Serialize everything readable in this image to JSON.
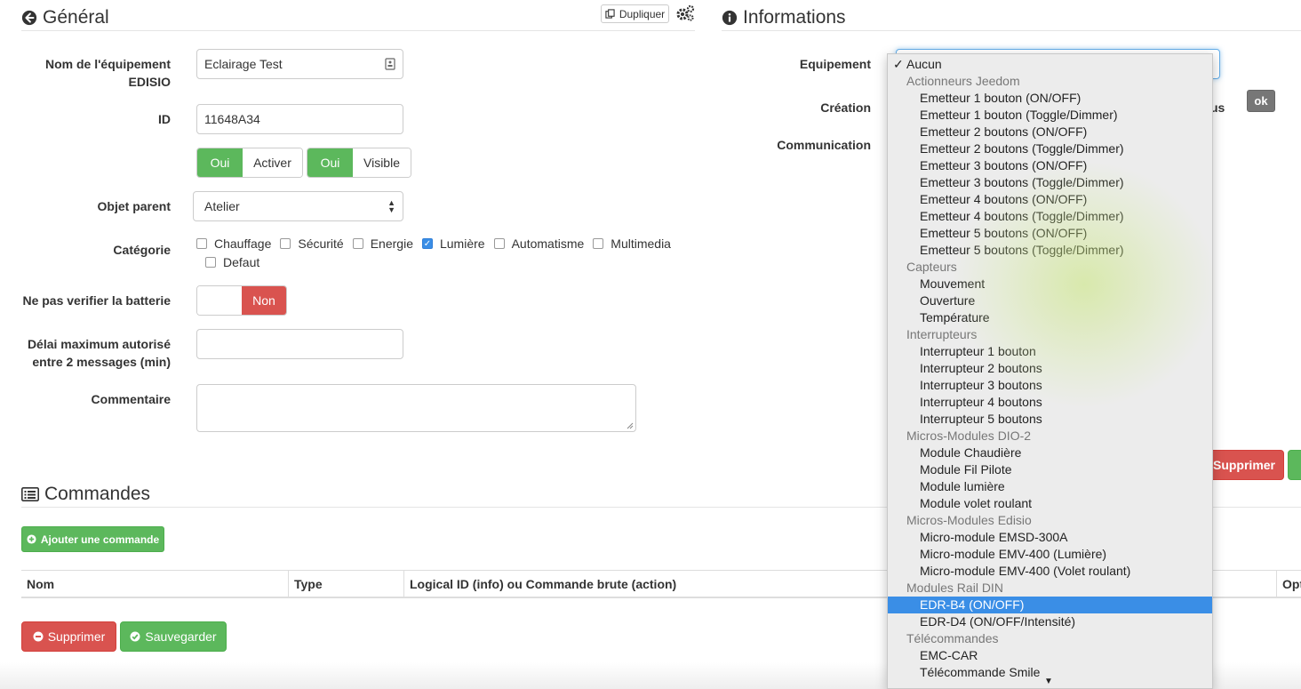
{
  "general": {
    "title": "Général",
    "duplicate_label": "Dupliquer",
    "fields": {
      "name_label": "Nom de l'équipement EDISIO",
      "name_value": "Eclairage Test",
      "id_label": "ID",
      "id_value": "11648A34",
      "activate_on": "Oui",
      "activate_label": "Activer",
      "visible_on": "Oui",
      "visible_label": "Visible",
      "parent_label": "Objet parent",
      "parent_value": "Atelier",
      "category_label": "Catégorie",
      "categories": [
        {
          "label": "Chauffage",
          "checked": false
        },
        {
          "label": "Sécurité",
          "checked": false
        },
        {
          "label": "Energie",
          "checked": false
        },
        {
          "label": "Lumière",
          "checked": true
        },
        {
          "label": "Automatisme",
          "checked": false
        },
        {
          "label": "Multimedia",
          "checked": false
        },
        {
          "label": "Defaut",
          "checked": false
        }
      ],
      "battery_label": "Ne pas verifier la batterie",
      "battery_value": "Non",
      "delay_label_1": "Délai maximum autorisé",
      "delay_label_2": "entre 2 messages (min)",
      "delay_value": "",
      "comment_label": "Commentaire",
      "comment_value": ""
    }
  },
  "informations": {
    "title": "Informations",
    "equipment_label": "Equipement",
    "creation_label": "Création",
    "communication_label": "Communication",
    "partial_text": "us",
    "ok_label": "ok",
    "delete_label": "Supprimer"
  },
  "commands": {
    "title": "Commandes",
    "add_label": "Ajouter une commande",
    "columns": [
      "Nom",
      "Type",
      "Logical ID (info) ou Commande brute (action)",
      "Opt"
    ]
  },
  "footer": {
    "delete_label": "Supprimer",
    "save_label": "Sauvegarder"
  },
  "dropdown": {
    "rows": [
      {
        "kind": "top",
        "label": "Aucun",
        "checked": true
      },
      {
        "kind": "group",
        "label": "Actionneurs Jeedom"
      },
      {
        "kind": "opt",
        "label": "Emetteur 1 bouton (ON/OFF)"
      },
      {
        "kind": "opt",
        "label": "Emetteur 1 bouton (Toggle/Dimmer)"
      },
      {
        "kind": "opt",
        "label": "Emetteur 2 boutons (ON/OFF)"
      },
      {
        "kind": "opt",
        "label": "Emetteur 2 boutons (Toggle/Dimmer)"
      },
      {
        "kind": "opt",
        "label": "Emetteur 3 boutons (ON/OFF)"
      },
      {
        "kind": "opt",
        "label": "Emetteur 3 boutons (Toggle/Dimmer)"
      },
      {
        "kind": "opt",
        "label": "Emetteur 4 boutons (ON/OFF)"
      },
      {
        "kind": "opt",
        "label": "Emetteur 4 boutons (Toggle/Dimmer)"
      },
      {
        "kind": "opt",
        "label": "Emetteur 5 boutons (ON/OFF)"
      },
      {
        "kind": "opt",
        "label": "Emetteur 5 boutons (Toggle/Dimmer)"
      },
      {
        "kind": "group",
        "label": "Capteurs"
      },
      {
        "kind": "opt",
        "label": "Mouvement"
      },
      {
        "kind": "opt",
        "label": "Ouverture"
      },
      {
        "kind": "opt",
        "label": "Température"
      },
      {
        "kind": "group",
        "label": "Interrupteurs"
      },
      {
        "kind": "opt",
        "label": "Interrupteur 1 bouton"
      },
      {
        "kind": "opt",
        "label": "Interrupteur 2 boutons"
      },
      {
        "kind": "opt",
        "label": "Interrupteur 3 boutons"
      },
      {
        "kind": "opt",
        "label": "Interrupteur 4 boutons"
      },
      {
        "kind": "opt",
        "label": "Interrupteur 5 boutons"
      },
      {
        "kind": "group",
        "label": "Micros-Modules DIO-2"
      },
      {
        "kind": "opt",
        "label": "Module Chaudière"
      },
      {
        "kind": "opt",
        "label": "Module Fil Pilote"
      },
      {
        "kind": "opt",
        "label": "Module lumière"
      },
      {
        "kind": "opt",
        "label": "Module volet roulant"
      },
      {
        "kind": "group",
        "label": "Micros-Modules Edisio"
      },
      {
        "kind": "opt",
        "label": "Micro-module EMSD-300A"
      },
      {
        "kind": "opt",
        "label": "Micro-module EMV-400 (Lumière)"
      },
      {
        "kind": "opt",
        "label": "Micro-module EMV-400 (Volet roulant)"
      },
      {
        "kind": "group",
        "label": "Modules Rail DIN"
      },
      {
        "kind": "opt",
        "label": "EDR-B4 (ON/OFF)",
        "selected": true
      },
      {
        "kind": "opt",
        "label": "EDR-D4 (ON/OFF/Intensité)"
      },
      {
        "kind": "group",
        "label": "Télécommandes"
      },
      {
        "kind": "opt",
        "label": "EMC-CAR"
      },
      {
        "kind": "opt",
        "label": "Télécommande Smile"
      }
    ]
  },
  "colors": {
    "green": "#5cb85c",
    "red": "#d9534f",
    "selection": "#3a8ee6"
  }
}
